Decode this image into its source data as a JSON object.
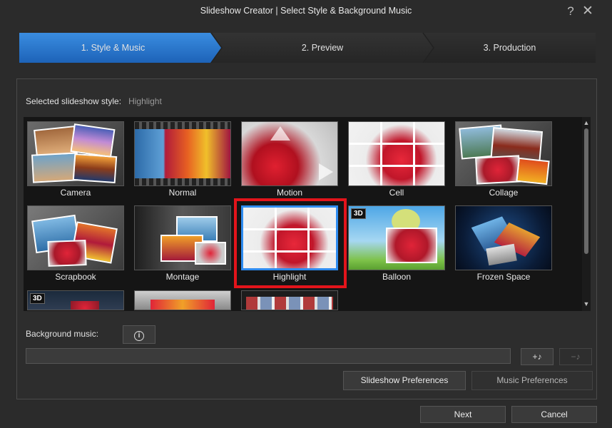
{
  "window": {
    "title": "Slideshow Creator | Select Style & Background Music",
    "help_label": "?",
    "close_label": "✕"
  },
  "steps": [
    {
      "label": "1. Style & Music",
      "active": true
    },
    {
      "label": "2. Preview",
      "active": false
    },
    {
      "label": "3. Production",
      "active": false
    }
  ],
  "style": {
    "label": "Selected slideshow style:",
    "value": "Highlight"
  },
  "styles": [
    {
      "name": "Camera",
      "badge": ""
    },
    {
      "name": "Normal",
      "badge": ""
    },
    {
      "name": "Motion",
      "badge": ""
    },
    {
      "name": "Cell",
      "badge": ""
    },
    {
      "name": "Collage",
      "badge": ""
    },
    {
      "name": "Scrapbook",
      "badge": ""
    },
    {
      "name": "Montage",
      "badge": ""
    },
    {
      "name": "Highlight",
      "badge": "",
      "selected": true
    },
    {
      "name": "Balloon",
      "badge": "3D"
    },
    {
      "name": "Frozen Space",
      "badge": ""
    },
    {
      "name": "",
      "badge": "3D"
    },
    {
      "name": "",
      "badge": ""
    },
    {
      "name": "",
      "badge": ""
    }
  ],
  "music": {
    "label": "Background music:",
    "info_icon": "i",
    "input_value": "",
    "add_label": "+♪",
    "remove_label": "−♪"
  },
  "buttons": {
    "slideshow_preferences": "Slideshow Preferences",
    "music_preferences": "Music Preferences",
    "next": "Next",
    "cancel": "Cancel"
  },
  "colors": {
    "accent": "#2f8cf0",
    "selection_highlight": "#e3141b",
    "active_step": "#2a78cf"
  }
}
